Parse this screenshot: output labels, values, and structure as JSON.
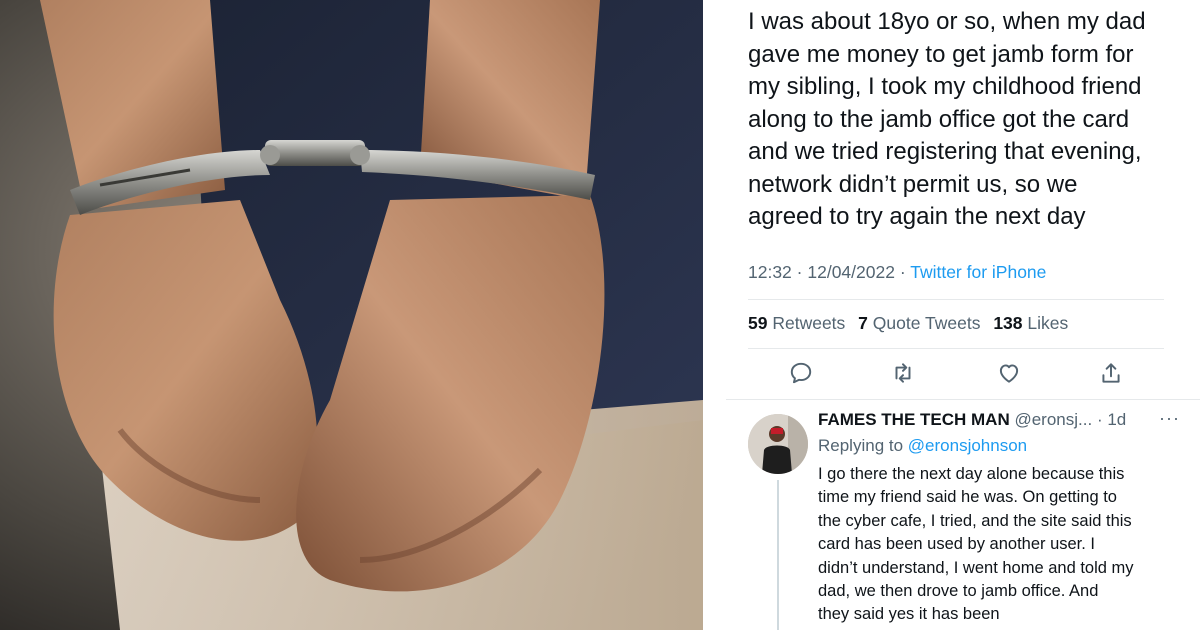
{
  "tweet": {
    "text": "I was about 18yo or so, when my dad\ngave me money to get jamb form for\nmy sibling, I took my childhood friend\nalong to the jamb office got the card\nand we tried registering that evening,\nnetwork didn’t permit us, so we\nagreed  to try again the next day",
    "time": "12:32",
    "date": "12/04/2022",
    "source": "Twitter for iPhone",
    "stats": {
      "retweets_count": "59",
      "retweets_label": "Retweets",
      "quotes_count": "7",
      "quotes_label": "Quote Tweets",
      "likes_count": "138",
      "likes_label": "Likes"
    },
    "actions": [
      "reply-icon",
      "retweet-icon",
      "like-icon",
      "share-icon"
    ]
  },
  "reply": {
    "name": "FAMES THE TECH MAN",
    "handle": "@eronsj...",
    "age": "1d",
    "more": "···",
    "replying_prefix": "Replying to",
    "replying_to": "@eronsjohnson",
    "text": "I go there the next day alone because this\ntime my friend said he was. On getting to\nthe cyber cafe, I tried, and the site said this\ncard has been used by another user. I\ndidn’t understand, I went home and told my\ndad, we then drove to jamb office. And\nthey said yes it has been"
  },
  "colors": {
    "text": "#0f1419",
    "muted": "#536471",
    "accent": "#1d9bf0",
    "divider": "#e6e9eb"
  }
}
